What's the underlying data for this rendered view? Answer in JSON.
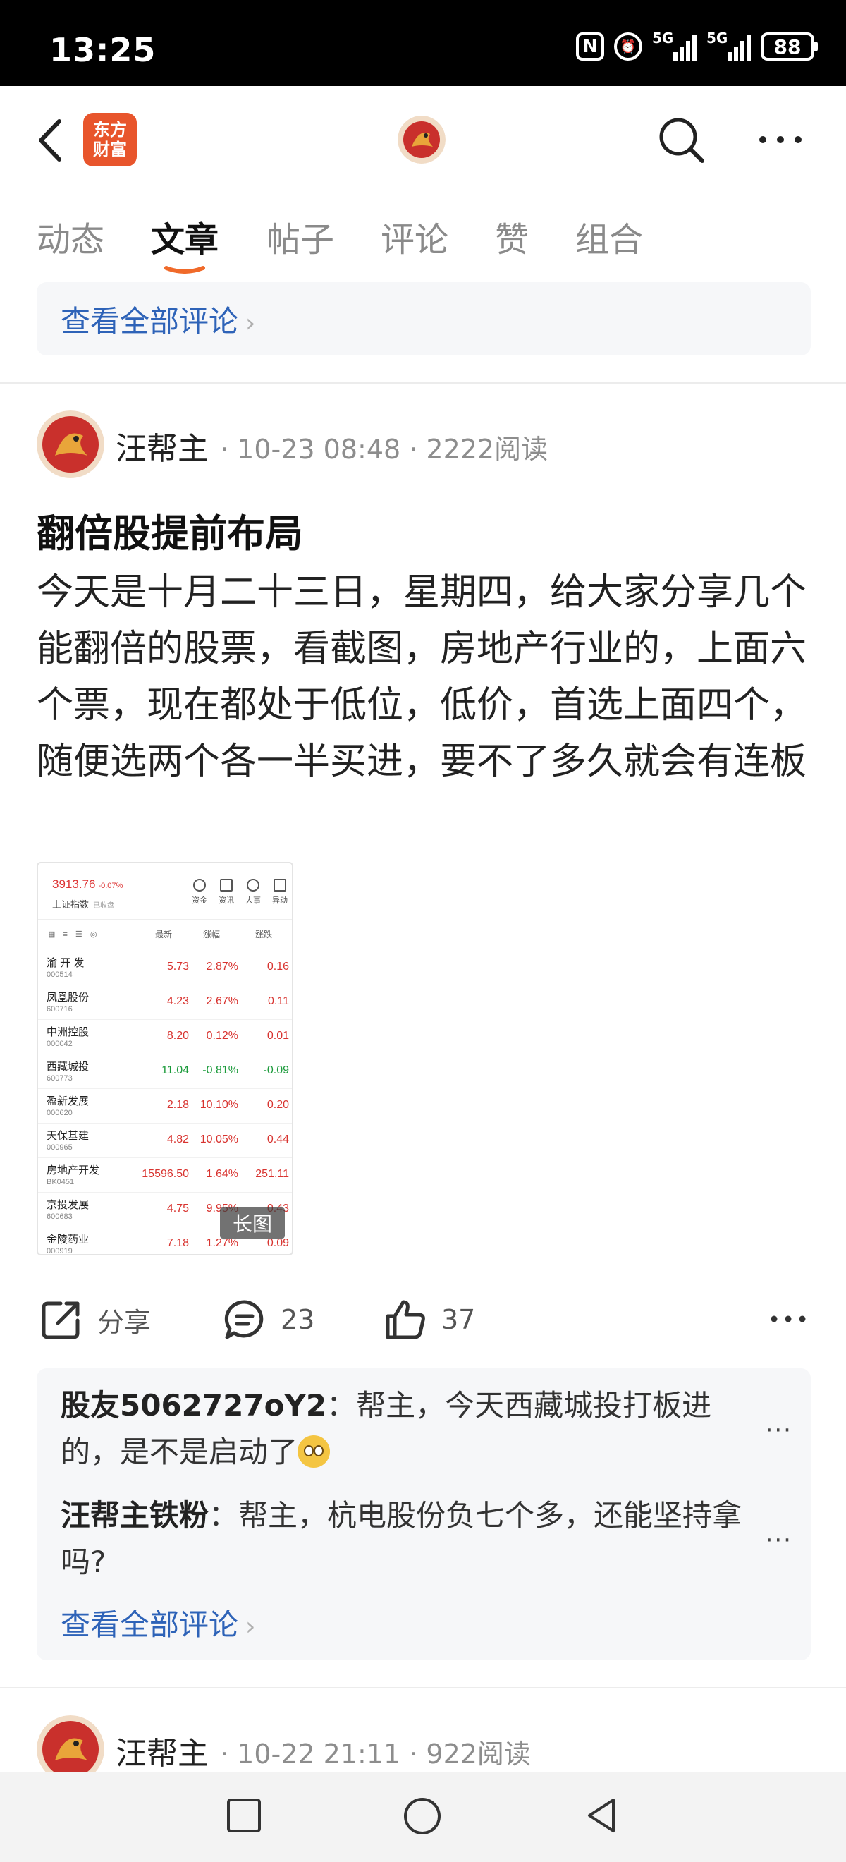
{
  "status_bar": {
    "time": "13:25",
    "nfc_icon": "N",
    "network1": "5G",
    "network2": "5G",
    "battery": "88"
  },
  "header": {
    "app_logo_line1": "东方",
    "app_logo_line2": "财富",
    "icons": [
      "back-arrow-icon",
      "avatar-icon",
      "search-icon",
      "more-icon"
    ]
  },
  "tabs": [
    {
      "label": "动态",
      "active": false
    },
    {
      "label": "文章",
      "active": true
    },
    {
      "label": "帖子",
      "active": false
    },
    {
      "label": "评论",
      "active": false
    },
    {
      "label": "赞",
      "active": false
    },
    {
      "label": "组合",
      "active": false
    }
  ],
  "top_comments": {
    "view_all": "查看全部评论"
  },
  "post": {
    "author": "汪帮主",
    "meta": "· 10-23 08:48 · 2222阅读",
    "title": "翻倍股提前布局",
    "body": "今天是十月二十三日，星期四，给大家分享几个能翻倍的股票，看截图，房地产行业的，上面六个票，现在都处于低位，低价，首选上面四个，随便选两个各一半买进，要不了多久就会有连板",
    "image": {
      "index_value": "3913.76",
      "index_change": "-0.07%",
      "index_name": "上证指数",
      "index_sub": "已收盘",
      "buttons": [
        "资金",
        "资讯",
        "大事",
        "异动"
      ],
      "columns": [
        "最新",
        "涨幅",
        "涨跌"
      ],
      "rows": [
        {
          "name": "渝 开 发",
          "code": "000514",
          "price": "5.73",
          "pct": "2.87%",
          "chg": "0.16",
          "dir": "up"
        },
        {
          "name": "凤凰股份",
          "code": "600716",
          "price": "4.23",
          "pct": "2.67%",
          "chg": "0.11",
          "dir": "up"
        },
        {
          "name": "中洲控股",
          "code": "000042",
          "price": "8.20",
          "pct": "0.12%",
          "chg": "0.01",
          "dir": "up"
        },
        {
          "name": "西藏城投",
          "code": "600773",
          "price": "11.04",
          "pct": "-0.81%",
          "chg": "-0.09",
          "dir": "down"
        },
        {
          "name": "盈新发展",
          "code": "000620",
          "price": "2.18",
          "pct": "10.10%",
          "chg": "0.20",
          "dir": "up"
        },
        {
          "name": "天保基建",
          "code": "000965",
          "price": "4.82",
          "pct": "10.05%",
          "chg": "0.44",
          "dir": "up"
        },
        {
          "name": "房地产开发",
          "code": "BK0451",
          "price": "15596.50",
          "pct": "1.64%",
          "chg": "251.11",
          "dir": "up"
        },
        {
          "name": "京投发展",
          "code": "600683",
          "price": "4.75",
          "pct": "9.95%",
          "chg": "0.43",
          "dir": "up"
        },
        {
          "name": "金陵药业",
          "code": "000919",
          "price": "7.18",
          "pct": "1.27%",
          "chg": "0.09",
          "dir": "up"
        }
      ],
      "badge": "长图"
    },
    "actions": {
      "share": "分享",
      "comments": "23",
      "likes": "37"
    },
    "comments": [
      {
        "user": "股友5062727oY2",
        "text": "帮主，今天西藏城投打板进的，是不是启动了"
      },
      {
        "user": "汪帮主铁粉",
        "text": "帮主，杭电股份负七个多，还能坚持拿吗?"
      }
    ],
    "view_all": "查看全部评论"
  },
  "next_post": {
    "author": "汪帮主",
    "meta": "· 10-22 21:11 · 922阅读"
  },
  "colors": {
    "accent": "#e8552c",
    "link": "#2e63b8",
    "up": "#d8332f",
    "down": "#1a9a3a"
  }
}
